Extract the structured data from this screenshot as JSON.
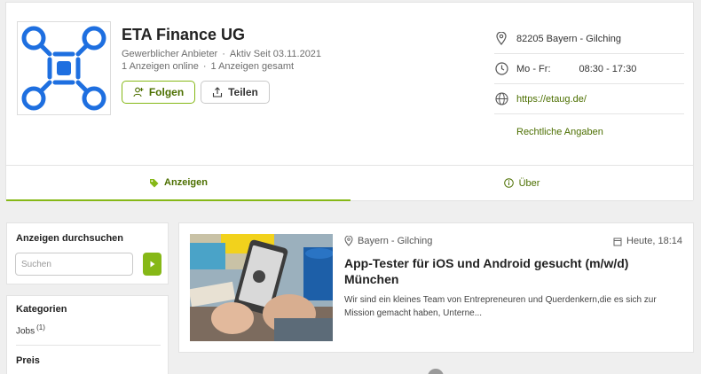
{
  "company": {
    "name": "ETA Finance UG",
    "seller_type": "Gewerblicher Anbieter",
    "active_since": "Aktiv Seit 03.11.2021",
    "ads_online": "1 Anzeigen online",
    "ads_total": "1 Anzeigen gesamt",
    "separator": "·"
  },
  "actions": {
    "follow_label": "Folgen",
    "share_label": "Teilen"
  },
  "info": {
    "location": "82205 Bayern - Gilching",
    "hours_days": "Mo - Fr:",
    "hours_time": "08:30 - 17:30",
    "website": "https://etaug.de/",
    "legal_link": "Rechtliche Angaben"
  },
  "tabs": {
    "ads": "Anzeigen",
    "about": "Über"
  },
  "sidebar": {
    "search_title": "Anzeigen durchsuchen",
    "search_placeholder": "Suchen",
    "categories_title": "Kategorien",
    "category_item": "Jobs",
    "category_count": "(1)",
    "price_title": "Preis"
  },
  "listing": {
    "location": "Bayern - Gilching",
    "date": "Heute, 18:14",
    "title": "App-Tester für iOS und Android gesucht (m/w/d) München",
    "description": "Wir sind ein kleines Team von Entrepreneuren und Querdenkern,die es sich zur Mission gemacht haben, Unterne..."
  },
  "colors": {
    "accent": "#86b817",
    "accent_text": "#4c6f00",
    "logo_blue": "#1e6fe0"
  }
}
